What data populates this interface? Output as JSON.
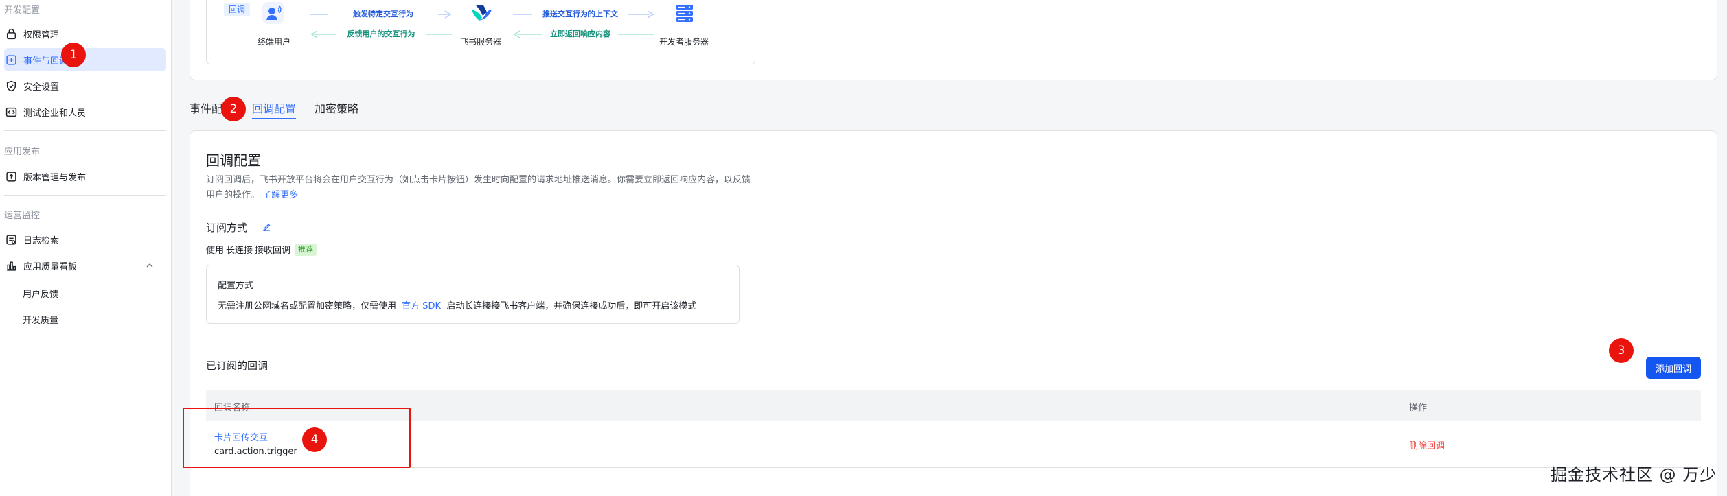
{
  "sidebar": {
    "groups": {
      "dev_config": "开发配置",
      "app_release": "应用发布",
      "ops_monitor": "运营监控"
    },
    "items": [
      {
        "label": "权限管理"
      },
      {
        "label": "事件与回调"
      },
      {
        "label": "安全设置"
      },
      {
        "label": "测试企业和人员"
      },
      {
        "label": "版本管理与发布"
      },
      {
        "label": "日志检索"
      },
      {
        "label": "应用质量看板"
      }
    ],
    "sub_items": [
      {
        "label": "用户反馈"
      },
      {
        "label": "开发质量"
      }
    ]
  },
  "flow": {
    "callback_tag": "回调",
    "nodes": {
      "end_user": "终端用户",
      "feishu_server": "飞书服务器",
      "dev_server": "开发者服务器"
    },
    "arrows": {
      "trigger": "触发特定交互行为",
      "feedback": "反馈用户的交互行为",
      "push_context": "推送交互行为的上下文",
      "return_response": "立即返回响应内容"
    }
  },
  "tabs": [
    {
      "label": "事件配置"
    },
    {
      "label": "回调配置"
    },
    {
      "label": "加密策略"
    }
  ],
  "main": {
    "title": "回调配置",
    "description": "订阅回调后，飞书开放平台将会在用户交互行为（如点击卡片按钮）发生时向配置的请求地址推送消息。你需要立即返回响应内容，以反馈用户的操作。",
    "learn_more": "了解更多",
    "subscribe_mode": {
      "title": "订阅方式",
      "use_prefix": "使用",
      "mode": "长连接",
      "use_suffix": "接收回调",
      "recommend_tag": "推荐"
    },
    "config_box": {
      "title": "配置方式",
      "text_before": "无需注册公网域名或配置加密策略，仅需使用",
      "sdk_link": "官方 SDK",
      "text_after": "启动长连接接飞书客户端，并确保连接成功后，即可开启该模式"
    },
    "subscribed": {
      "title": "已订阅的回调",
      "add_button": "添加回调",
      "columns": [
        "回调名称",
        "操作"
      ],
      "rows": [
        {
          "name": "卡片回传交互",
          "id": "card.action.trigger",
          "action": "删除回调"
        }
      ]
    }
  },
  "annotations": {
    "badges": [
      "1",
      "2",
      "3",
      "4"
    ]
  },
  "watermark": "掘金技术社区 @ 万少",
  "colors": {
    "accent": "#3370ff",
    "primary_button": "#1456f0",
    "danger": "#f54a45",
    "annotation_red": "#e8140d",
    "recommend_green": "#2ea121"
  }
}
